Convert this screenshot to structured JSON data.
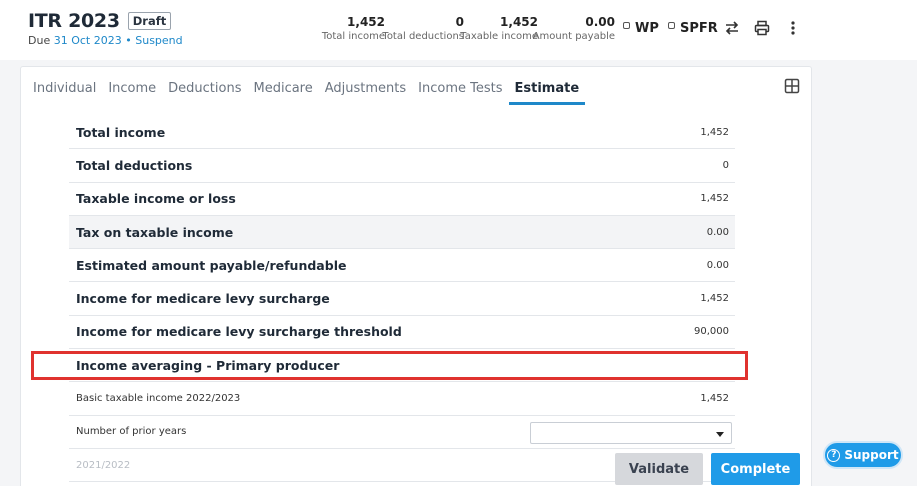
{
  "header": {
    "title": "ITR 2023",
    "status_badge": "Draft",
    "due_prefix": "Due",
    "due_date": "31 Oct 2023",
    "separator": "•",
    "suspend_label": "Suspend"
  },
  "summary": [
    {
      "value": "1,452",
      "label": "Total income"
    },
    {
      "value": "0",
      "label": "Total deductions"
    },
    {
      "value": "1,452",
      "label": "Taxable income"
    },
    {
      "value": "0.00",
      "label": "Amount payable"
    }
  ],
  "toggles": {
    "wp_label": "WP",
    "spfr_label": "SPFR"
  },
  "icons": {
    "swap": "swap-arrows-icon",
    "print": "printer-icon",
    "more": "kebab-menu-icon",
    "grid": "grid-icon",
    "support": "question-circle-icon"
  },
  "tabs": [
    "Individual",
    "Income",
    "Deductions",
    "Medicare",
    "Adjustments",
    "Income Tests",
    "Estimate"
  ],
  "active_tab": "Estimate",
  "rows": [
    {
      "label": "Total income",
      "value": "1,452"
    },
    {
      "label": "Total deductions",
      "value": "0"
    },
    {
      "label": "Taxable income or loss",
      "value": "1,452"
    },
    {
      "label": "Tax on taxable income",
      "value": "0.00"
    },
    {
      "label": "Estimated amount payable/refundable",
      "value": "0.00"
    },
    {
      "label": "Income for medicare levy surcharge",
      "value": "1,452"
    },
    {
      "label": "Income for medicare levy surcharge threshold",
      "value": "90,000"
    },
    {
      "label": "Income averaging - Primary producer",
      "value": ""
    },
    {
      "label": "Basic taxable income 2022/2023",
      "value": "1,452"
    },
    {
      "label": "Number of prior years",
      "value": ""
    },
    {
      "label": "2021/2022",
      "value": ""
    }
  ],
  "buttons": {
    "validate": "Validate",
    "complete": "Complete",
    "support": "Support"
  },
  "colors": {
    "accent": "#1f9be8",
    "highlight": "#e0322f"
  }
}
